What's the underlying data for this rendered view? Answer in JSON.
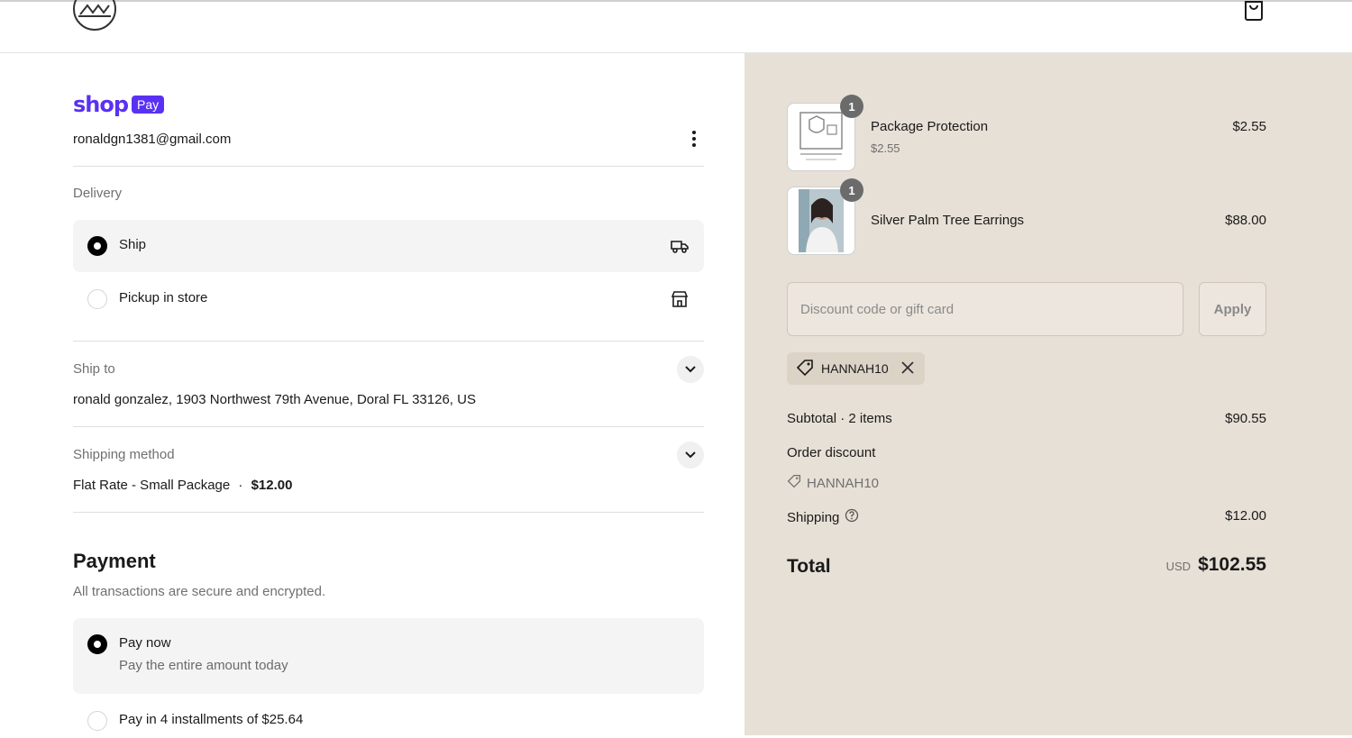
{
  "header": {
    "logo_icon": "brand-logo-icon",
    "cart_icon": "shopping-bag-icon"
  },
  "shop_pay": {
    "word": "shop",
    "badge": "Pay",
    "email": "ronaldgn1381@gmail.com"
  },
  "delivery": {
    "label": "Delivery",
    "options": [
      {
        "label": "Ship",
        "selected": true,
        "icon": "truck-icon"
      },
      {
        "label": "Pickup in store",
        "selected": false,
        "icon": "store-icon"
      }
    ]
  },
  "ship_to": {
    "label": "Ship to",
    "value": "ronald gonzalez, 1903 Northwest 79th Avenue, Doral FL 33126, US"
  },
  "shipping_method": {
    "label": "Shipping method",
    "name": "Flat Rate - Small Package",
    "separator": "·",
    "price": "$12.00"
  },
  "payment": {
    "title": "Payment",
    "subtitle": "All transactions are secure and encrypted.",
    "options": [
      {
        "label": "Pay now",
        "sub": "Pay the entire amount today",
        "selected": true
      },
      {
        "label": "Pay in 4 installments of $25.64",
        "selected": false
      }
    ]
  },
  "cart": {
    "items": [
      {
        "name": "Package Protection",
        "sub": "$2.55",
        "price": "$2.55",
        "qty": "1"
      },
      {
        "name": "Silver Palm Tree Earrings",
        "price": "$88.00",
        "qty": "1"
      }
    ],
    "discount_placeholder": "Discount code or gift card",
    "apply_label": "Apply",
    "applied_code": "HANNAH10",
    "subtotal_label": "Subtotal · 2 items",
    "subtotal_value": "$90.55",
    "order_discount_label": "Order discount",
    "order_discount_code": "HANNAH10",
    "shipping_label": "Shipping",
    "shipping_value": "$12.00",
    "total_label": "Total",
    "currency": "USD",
    "total_value": "$102.55"
  },
  "colors": {
    "shop_purple": "#5a31f4",
    "summary_bg": "#e7e0d6"
  }
}
